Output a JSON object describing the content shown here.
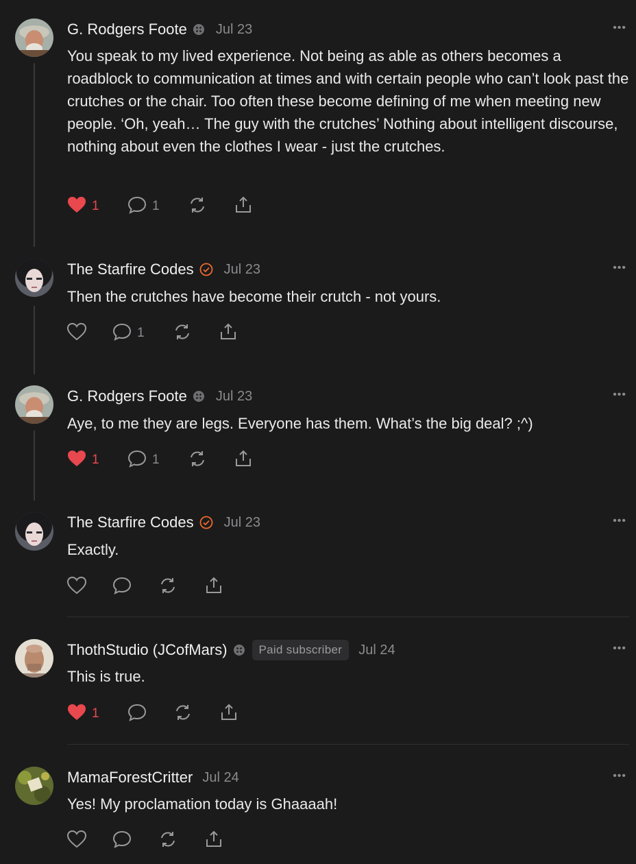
{
  "comments": [
    {
      "author": "G. Rodgers Foote",
      "badge": "subscriber-badge-icon",
      "date": "Jul 23",
      "text": "You speak to my lived experience. Not being as able as others becomes a roadblock to communication at times and with certain people who can’t look past the crutches or the chair. Too often these become defining of me when meeting new people. ‘Oh, yeah… The guy with the crutches’ Nothing about intelligent discourse, nothing about even the clothes I wear - just the crutches.",
      "likes": "1",
      "replies": "1",
      "liked": true
    },
    {
      "author": "The Starfire Codes",
      "badge": "verified-badge-icon",
      "date": "Jul 23",
      "text": "Then the crutches have become their crutch - not yours.",
      "likes": "",
      "replies": "1",
      "liked": false
    },
    {
      "author": "G. Rodgers Foote",
      "badge": "subscriber-badge-icon",
      "date": "Jul 23",
      "text": "Aye, to me they are legs. Everyone has them. What’s the big deal? ;^)",
      "likes": "1",
      "replies": "1",
      "liked": true
    },
    {
      "author": "The Starfire Codes",
      "badge": "verified-badge-icon",
      "date": "Jul 23",
      "text": "Exactly.",
      "likes": "",
      "replies": "",
      "liked": false
    },
    {
      "author": "ThothStudio (JCofMars)",
      "badge": "subscriber-badge-icon",
      "paid_label": "Paid subscriber",
      "date": "Jul 24",
      "text": "This is true.",
      "likes": "1",
      "replies": "",
      "liked": true
    },
    {
      "author": "MamaForestCritter",
      "badge": "",
      "date": "Jul 24",
      "text": "Yes! My proclamation today is Ghaaaah!",
      "likes": "",
      "replies": "",
      "liked": false
    }
  ],
  "more_label": "•••",
  "colors": {
    "like": "#e8484e",
    "verified": "#ef6a2b",
    "muted": "#8b8b8d",
    "background": "#1b1b1c"
  }
}
